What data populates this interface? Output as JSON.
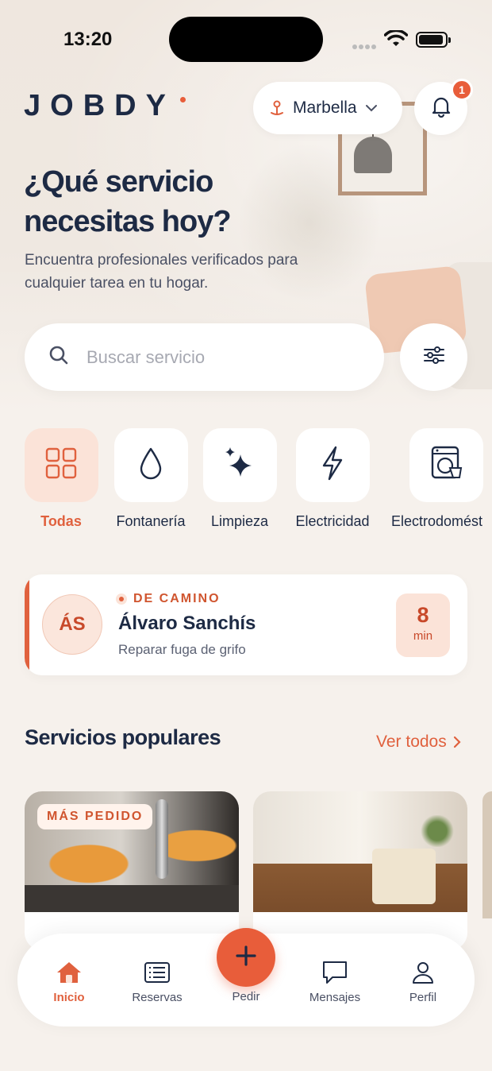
{
  "status_bar": {
    "time": "13:20"
  },
  "header": {
    "logo": "JOBDY",
    "location": "Marbella",
    "notifications_count": "1"
  },
  "hero": {
    "title": "¿Qué servicio necesitas hoy?",
    "subtitle": "Encuentra profesionales verificados para cualquier tarea en tu hogar."
  },
  "search": {
    "placeholder": "Buscar servicio"
  },
  "categories": [
    {
      "label": "Todas",
      "icon": "grid-icon",
      "active": true
    },
    {
      "label": "Fontanería",
      "icon": "water-drop-icon"
    },
    {
      "label": "Limpieza",
      "icon": "sparkles-icon"
    },
    {
      "label": "Electricidad",
      "icon": "lightning-icon"
    },
    {
      "label": "Electrodomést",
      "icon": "washing-machine-icon"
    }
  ],
  "active_booking": {
    "initials": "ÁS",
    "status": "DE CAMINO",
    "name": "Álvaro Sanchís",
    "task": "Reparar fuga de grifo",
    "eta_value": "8",
    "eta_unit": "min"
  },
  "popular": {
    "title": "Servicios populares",
    "see_all": "Ver todos",
    "cards": [
      {
        "badge": "MÁS PEDIDO"
      },
      {
        "badge": ""
      }
    ]
  },
  "tabbar": {
    "items": [
      {
        "label": "Inicio",
        "icon": "home-icon",
        "active": true
      },
      {
        "label": "Reservas",
        "icon": "list-icon"
      },
      {
        "label": "Pedir",
        "icon": "plus-icon"
      },
      {
        "label": "Mensajes",
        "icon": "chat-icon"
      },
      {
        "label": "Perfil",
        "icon": "user-icon"
      }
    ]
  },
  "colors": {
    "accent": "#e85d3a",
    "navy": "#1d2a44",
    "background": "#f6f1ec"
  }
}
